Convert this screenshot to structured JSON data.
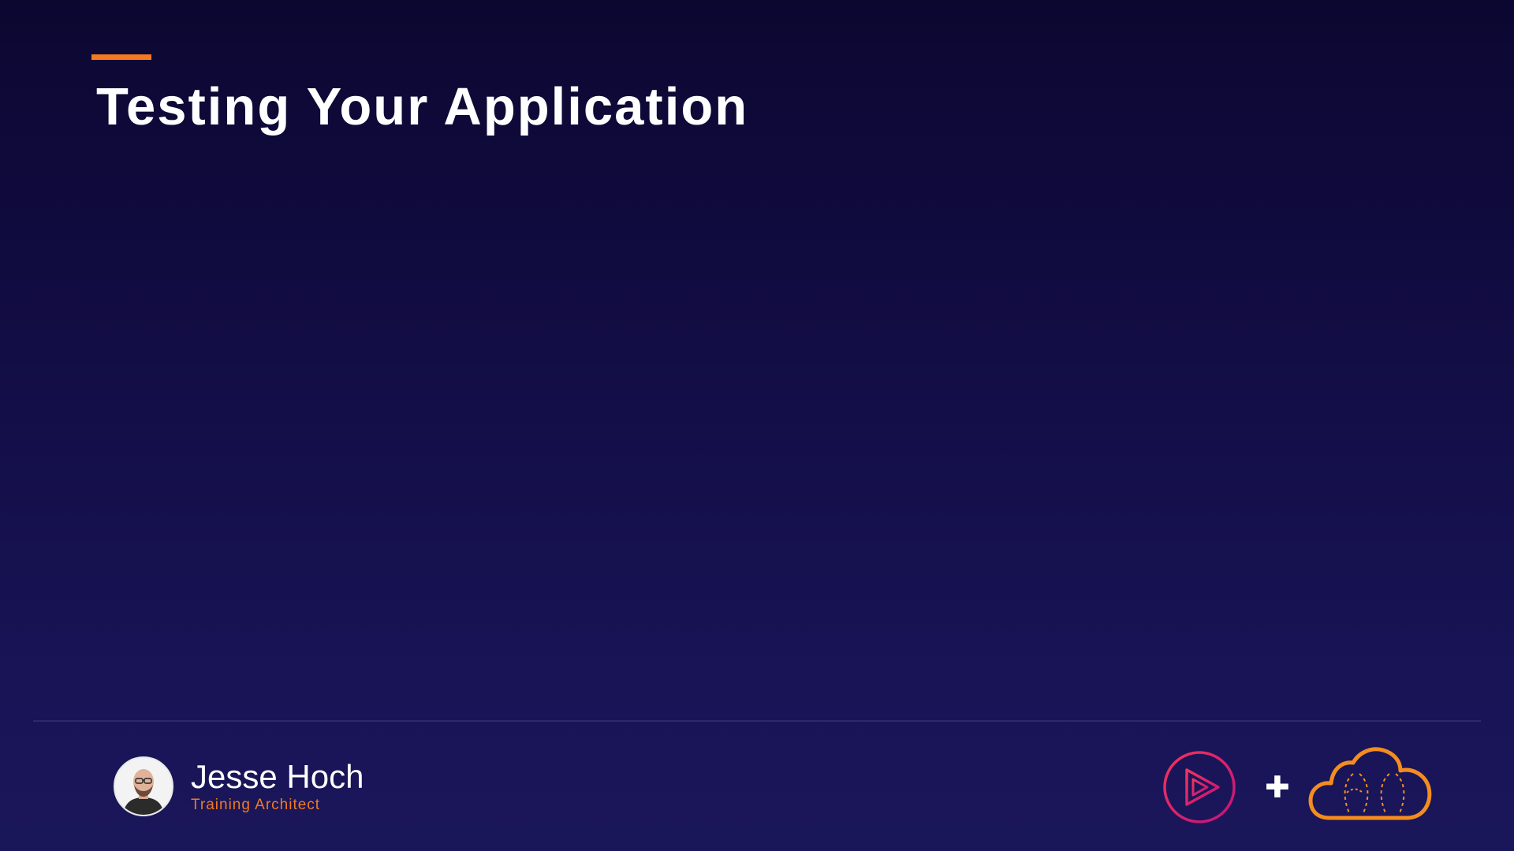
{
  "slide": {
    "title": "Testing Your Application",
    "accent_color": "#f47920"
  },
  "presenter": {
    "name": "Jesse Hoch",
    "role": "Training Architect",
    "avatar_icon": "presenter-photo"
  },
  "logos": {
    "left_icon": "play-logo-icon",
    "separator": "✚",
    "right_icon": "cloud-logo-icon"
  },
  "colors": {
    "background_top": "#0c0731",
    "background_bottom": "#1a165a",
    "accent": "#f47920",
    "play_logo_gradient": [
      "#f0355d",
      "#c2127a"
    ],
    "cloud_logo": "#f48d1f"
  }
}
